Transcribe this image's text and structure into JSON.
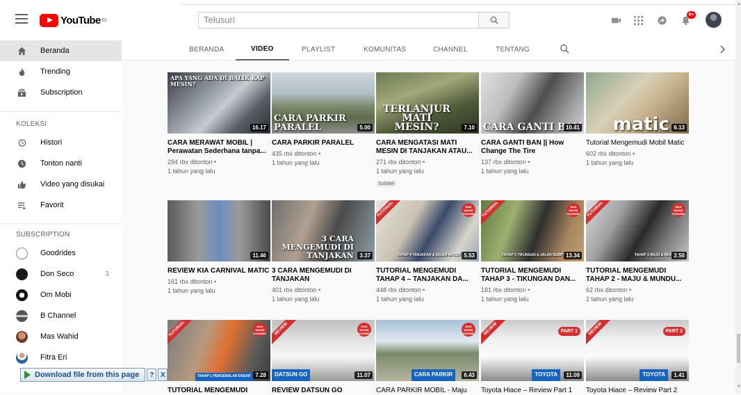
{
  "masthead": {
    "logo_text": "YouTube",
    "logo_sup": "ID",
    "search_placeholder": "Telusuri",
    "notification_count": "9+"
  },
  "sidebar": {
    "main": [
      {
        "label": "Beranda",
        "icon": "home-icon"
      },
      {
        "label": "Trending",
        "icon": "fire-icon"
      },
      {
        "label": "Subscription",
        "icon": "subscriptions-icon"
      }
    ],
    "koleksi_header": "KOLEKSI",
    "koleksi": [
      {
        "label": "Histori",
        "icon": "history-icon"
      },
      {
        "label": "Tonton nanti",
        "icon": "clock-icon"
      },
      {
        "label": "Video yang disukai",
        "icon": "thumbs-up-icon"
      },
      {
        "label": "Favorit",
        "icon": "playlist-icon"
      }
    ],
    "subscription_header": "SUBSCRIPTION",
    "subscriptions": [
      {
        "label": "Goodrides",
        "count": ""
      },
      {
        "label": "Don Seco",
        "count": "3"
      },
      {
        "label": "Om Mobi",
        "count": ""
      },
      {
        "label": "B Channel",
        "count": ""
      },
      {
        "label": "Mas Wahid",
        "count": ""
      },
      {
        "label": "Fitra Eri",
        "count": ""
      }
    ]
  },
  "tabs": [
    {
      "label": "BERANDA"
    },
    {
      "label": "VIDEO"
    },
    {
      "label": "PLAYLIST"
    },
    {
      "label": "KOMUNITAS"
    },
    {
      "label": "CHANNEL"
    },
    {
      "label": "TENTANG"
    }
  ],
  "videos": [
    {
      "title": "CARA MERAWAT MOBIL | Perawatan Sederhana tanpa...",
      "views": "294 rbx ditonton •",
      "age": "1 tahun yang lalu",
      "duration": "16.17",
      "thumb_text": "APA YANG ADA DI BALIK KAP MESIN?",
      "badge": ""
    },
    {
      "title": "CARA PARKIR PARALEL",
      "views": "435 rbx ditonton •",
      "age": "1 tahun yang lalu",
      "duration": "5.00",
      "thumb_text": "CARA PARKIR PARALEL",
      "badge": ""
    },
    {
      "title": "CARA MENGATASI MATI MESIN DI TANJAKAN ATAU...",
      "views": "271 rbx ditonton •",
      "age": "1 tahun yang lalu",
      "duration": "7.10",
      "thumb_text": "TERLANJUR MATI MESIN?",
      "badge": "Subtitel"
    },
    {
      "title": "CARA GANTI BAN || How Change The Tire",
      "views": "137 rbx ditonton •",
      "age": "1 tahun yang lalu",
      "duration": "10.41",
      "thumb_text": "CARA GANTI BAN",
      "badge": ""
    },
    {
      "title": "Tutorial Mengemudi Mobil Matic",
      "views": "602 rbx ditonton •",
      "age": "1 tahun yang lalu",
      "duration": "6.13",
      "thumb_text": "matic",
      "badge": ""
    },
    {
      "title": "REVIEW KIA CARNIVAL MATIC",
      "views": "161 rbx ditonton •",
      "age": "1 tahun yang lalu",
      "duration": "11.46",
      "thumb_text": "",
      "badge": ""
    },
    {
      "title": "3 CARA MENGEMUDI DI TANJAKAN",
      "views": "401 rbx ditonton •",
      "age": "1 tahun yang lalu",
      "duration": "3.37",
      "thumb_text": "3 CARA MENGEMUDI DI TANJAKAN",
      "badge": ""
    },
    {
      "title": "TUTORIAL MENGEMUDI TAHAP 4 – TANJAKAN DA...",
      "views": "448 rbx ditonton •",
      "age": "1 tahun yang lalu",
      "duration": "5.53",
      "thumb_text": "TAHAP 4 TANJAKAN & JALAN MACET",
      "badge": ""
    },
    {
      "title": "TUTORIAL MENGEMUDI TAHAP 3 - TIKUNGAN DAN...",
      "views": "181 rbx ditonton •",
      "age": "1 tahun yang lalu",
      "duration": "13.34",
      "thumb_text": "TAHAP 3 TIKUNGAN & JALAN SEMPIT",
      "badge": ""
    },
    {
      "title": "TUTORIAL MENGEMUDI TAHAP 2 - MAJU & MUNDU...",
      "views": "62 rbx ditonton •",
      "age": "2 tahun yang lalu",
      "duration": "2.50",
      "thumb_text": "TAHAP 2 MAJU & MUNDUR",
      "badge": ""
    },
    {
      "title": "TUTORIAL MENGEMUDI",
      "views": "",
      "age": "",
      "duration": "7.28",
      "thumb_text": "TAHAP 1 PENGENALAN DASAR",
      "badge": ""
    },
    {
      "title": "REVIEW DATSUN GO",
      "views": "",
      "age": "",
      "duration": "11.07",
      "thumb_text": "DATSUN GO",
      "badge": ""
    },
    {
      "title": "CARA PARKIR MOBIL - Maju",
      "views": "",
      "age": "",
      "duration": "6.43",
      "thumb_text": "CARA PARKIR",
      "badge": ""
    },
    {
      "title": "Toyota Hiace – Review Part 1",
      "views": "",
      "age": "",
      "duration": "11.09",
      "thumb_text": "TOYOTA",
      "badge": "PART 1"
    },
    {
      "title": "Toyota Hiace – Review Part 2",
      "views": "",
      "age": "",
      "duration": "1.41",
      "thumb_text": "TOYOTA",
      "badge": "PART 2"
    }
  ],
  "thumb_extras": {
    "ribbon_tutorial": "TUTORIAL",
    "ribbon_review": "REVIEW",
    "channel_logo": "MAS WAHID CHANNEL"
  },
  "download_bar": {
    "label": "Download file from this page",
    "help": "?",
    "close": "X"
  },
  "colors": {
    "accent": "#ff0000",
    "sidebar_active": "#e5e5e5",
    "meta_text": "#606060"
  }
}
